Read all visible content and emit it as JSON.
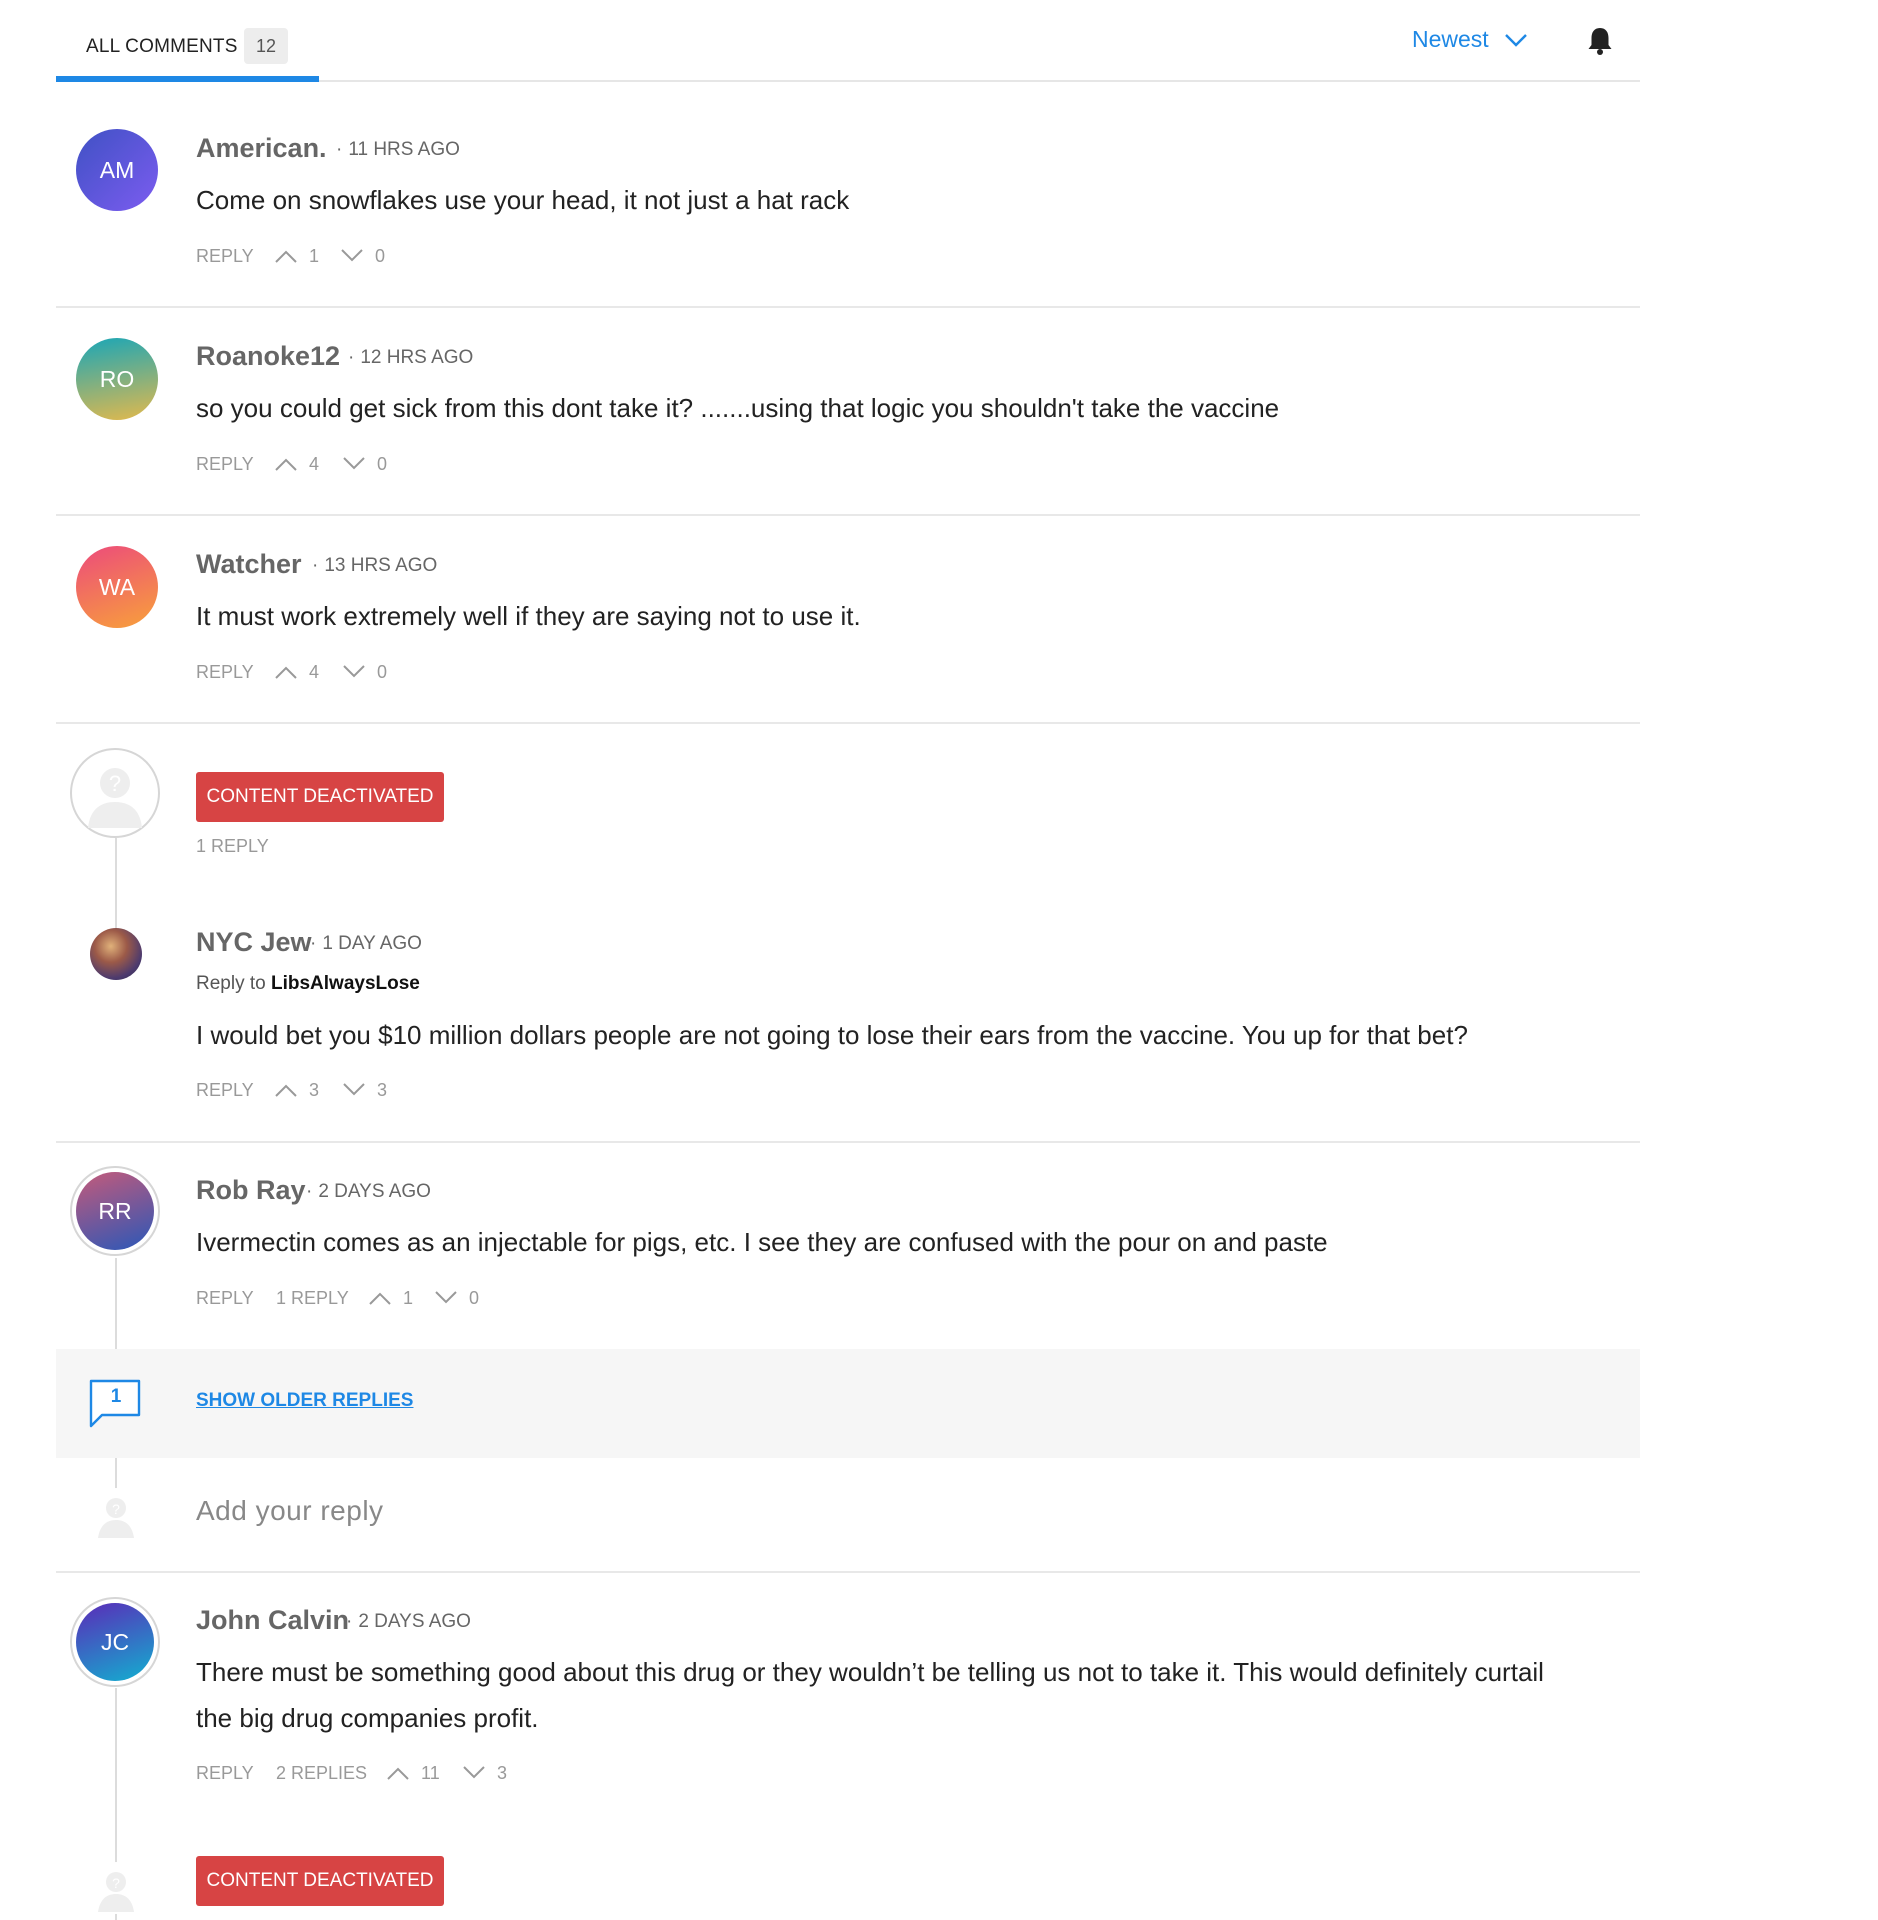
{
  "header": {
    "all_comments_label": "ALL COMMENTS",
    "comment_count": "12",
    "sort_label": "Newest"
  },
  "common": {
    "reply_label": "REPLY",
    "content_deactivated": "CONTENT DEACTIVATED"
  },
  "comments": [
    {
      "initials": "AM",
      "author": "American.",
      "time": "11 HRS AGO",
      "text": "Come on snowflakes use your head, it not just a hat rack",
      "upvotes": "1",
      "downvotes": "0"
    },
    {
      "initials": "RO",
      "author": "Roanoke12",
      "time": "12 HRS AGO",
      "text": "so you could get sick from this dont take it? .......using that logic you shouldn't take the vaccine",
      "upvotes": "4",
      "downvotes": "0"
    },
    {
      "initials": "WA",
      "author": "Watcher",
      "time": "13 HRS AGO",
      "text": "It must work extremely well if they are saying not to use it.",
      "upvotes": "4",
      "downvotes": "0"
    }
  ],
  "deactivated_thread": {
    "replies_label": "1 REPLY",
    "reply": {
      "author": "NYC Jew",
      "time": "1 DAY AGO",
      "reply_to_prefix": "Reply to",
      "reply_to_user": "LibsAlwaysLose",
      "text": "I would bet you $10 million dollars people are not going to lose their ears from the vaccine. You up for that bet?",
      "upvotes": "3",
      "downvotes": "3"
    }
  },
  "rob_ray": {
    "initials": "RR",
    "author": "Rob Ray",
    "time": "2 DAYS AGO",
    "text": "Ivermectin comes as an injectable for pigs, etc. I see they are confused with the pour on and paste",
    "replies_label": "1 REPLY",
    "upvotes": "1",
    "downvotes": "0",
    "older_replies_count": "1",
    "show_older_replies": "SHOW OLDER REPLIES",
    "add_reply_placeholder": "Add your reply"
  },
  "john_calvin": {
    "initials": "JC",
    "author": "John Calvin",
    "time": "2 DAYS AGO",
    "text_line1": "There must be something good about this drug or they wouldn’t be telling us not to take it. This would definitely curtail",
    "text_line2": "the big drug companies profit.",
    "replies_label": "2 REPLIES",
    "upvotes": "11",
    "downvotes": "3"
  },
  "colors": {
    "accent": "#1e88e5",
    "deactivated": "#d74444",
    "avatar_am": [
      "#3f51c4",
      "#7c5cf0"
    ],
    "avatar_ro": [
      "#1aa6b7",
      "#e3b94c"
    ],
    "avatar_wa": [
      "#ec4a7c",
      "#f8a13a"
    ],
    "avatar_rr": [
      "#2a57b8",
      "#c55a7a"
    ],
    "avatar_jc": [
      "#5b2ab8",
      "#12b0d0"
    ]
  },
  "icons": [
    "chevron-down-icon",
    "bell-icon",
    "upvote-icon",
    "downvote-icon",
    "anonymous-avatar-icon",
    "speech-bubble-icon"
  ]
}
